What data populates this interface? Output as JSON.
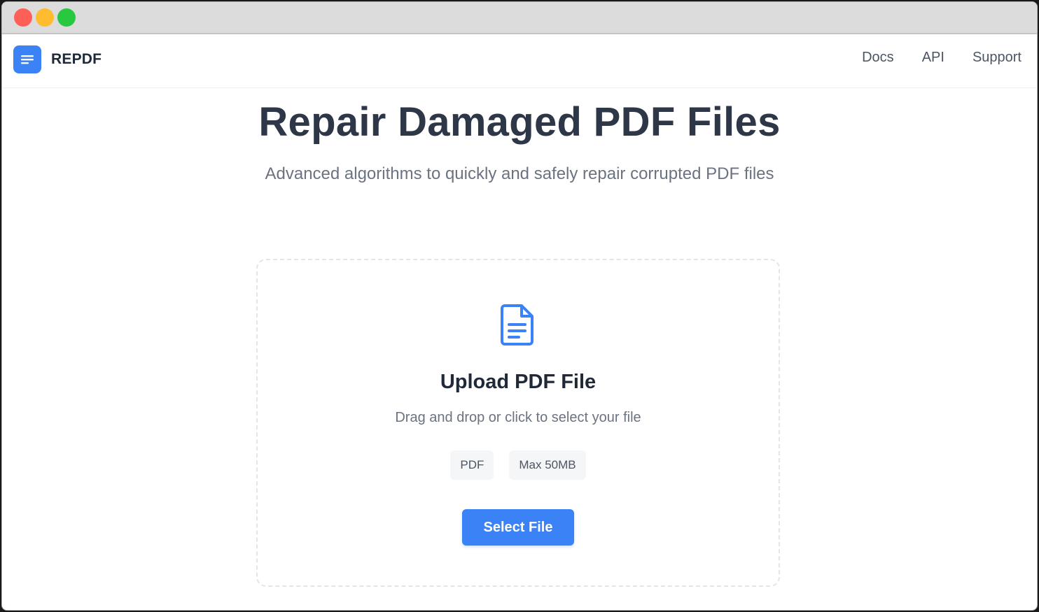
{
  "window": {
    "controls": [
      "close",
      "minimize",
      "maximize"
    ]
  },
  "navbar": {
    "brand": "REPDF",
    "brand_icon": "document-lines-icon",
    "links": [
      {
        "label": "Docs"
      },
      {
        "label": "API"
      },
      {
        "label": "Support"
      }
    ]
  },
  "hero": {
    "title": "Repair Damaged PDF Files",
    "subtitle": "Advanced algorithms to quickly and safely repair corrupted PDF files"
  },
  "upload": {
    "icon": "document-icon",
    "title": "Upload PDF File",
    "hint": "Drag and drop or click to select your file",
    "chips": [
      "PDF",
      "Max 50MB"
    ],
    "button_label": "Select File"
  },
  "colors": {
    "accent": "#3b82f6",
    "heading": "#2d3748",
    "muted": "#6b7280"
  }
}
